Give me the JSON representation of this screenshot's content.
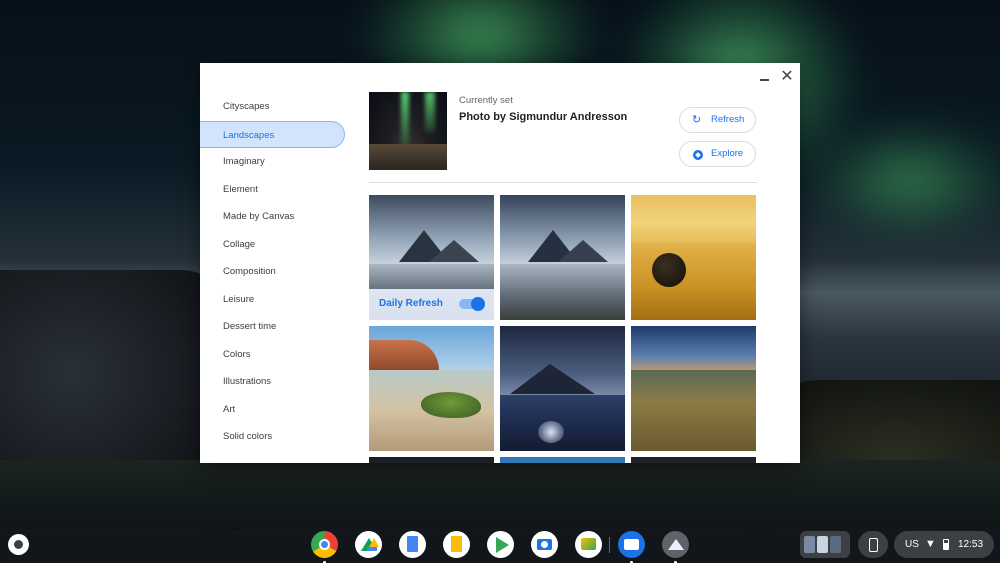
{
  "dialog": {
    "window_controls": {
      "minimize": "",
      "close": "✕"
    },
    "sidebar": {
      "items": [
        {
          "label": "Cityscapes",
          "active": false
        },
        {
          "label": "Landscapes",
          "active": true
        },
        {
          "label": "Imaginary",
          "active": false
        },
        {
          "label": "Element",
          "active": false
        },
        {
          "label": "Made by Canvas",
          "active": false
        },
        {
          "label": "Collage",
          "active": false
        },
        {
          "label": "Composition",
          "active": false
        },
        {
          "label": "Leisure",
          "active": false
        },
        {
          "label": "Dessert time",
          "active": false
        },
        {
          "label": "Colors",
          "active": false
        },
        {
          "label": "Illustrations",
          "active": false
        },
        {
          "label": "Art",
          "active": false
        },
        {
          "label": "Solid colors",
          "active": false
        }
      ]
    },
    "current": {
      "label": "Currently set",
      "title": "Photo by Sigmundur Andresson",
      "refresh_label": "Refresh",
      "refresh_icon": "↻",
      "explore_label": "Explore",
      "explore_icon": "compass-icon"
    },
    "daily_refresh": {
      "label": "Daily Refresh",
      "enabled": true
    },
    "accent_color": "#1a73e8"
  },
  "shelf": {
    "apps": [
      {
        "name": "chrome",
        "icon": "chrome-icon"
      },
      {
        "name": "drive",
        "icon": "drive-icon"
      },
      {
        "name": "docs",
        "icon": "docs-icon"
      },
      {
        "name": "slides",
        "icon": "slides-icon"
      },
      {
        "name": "play-store",
        "icon": "play-store-icon"
      },
      {
        "name": "camera",
        "icon": "camera-icon"
      },
      {
        "name": "gallery",
        "icon": "gallery-icon"
      },
      {
        "name": "files",
        "icon": "files-icon"
      },
      {
        "name": "wallpaper",
        "icon": "wallpaper-icon"
      }
    ],
    "tray": {
      "ime": "US",
      "time": "12:53"
    }
  }
}
